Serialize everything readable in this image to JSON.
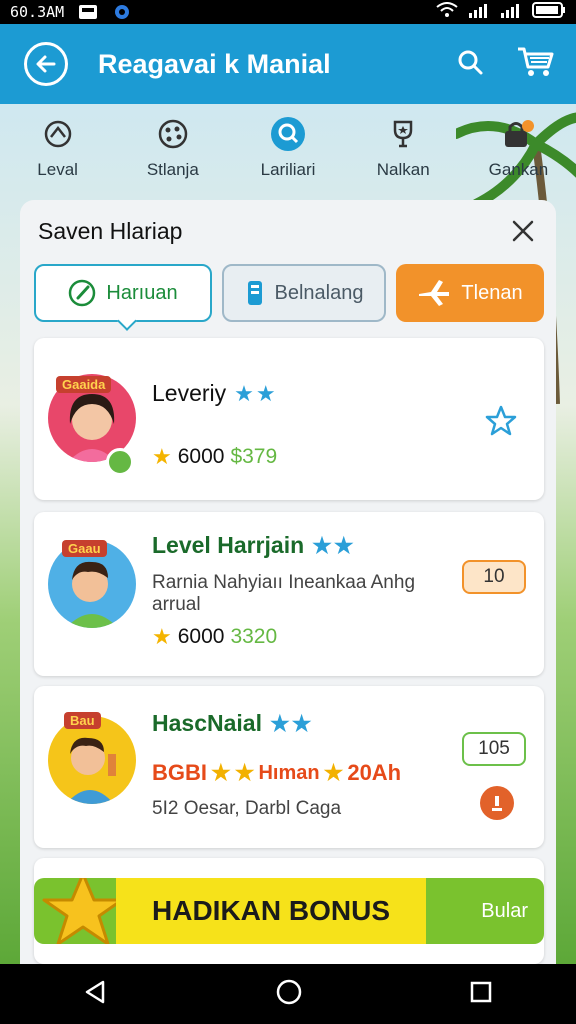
{
  "status": {
    "time": "60.3AM"
  },
  "appbar": {
    "title": "Reagavai k Manial"
  },
  "categories": [
    {
      "label": "Leval",
      "icon": "puzzle-icon"
    },
    {
      "label": "Stlanja",
      "icon": "palette-icon"
    },
    {
      "label": "Lariliari",
      "icon": "search-circle-icon"
    },
    {
      "label": "Nalkan",
      "icon": "trophy-icon"
    },
    {
      "label": "Gankan",
      "icon": "lock-icon"
    }
  ],
  "panel": {
    "title": "Saven Hlariap",
    "tabs": [
      {
        "label": "Harıuan"
      },
      {
        "label": "Belnalang"
      },
      {
        "label": "Tlenan"
      }
    ]
  },
  "cards": [
    {
      "title": "Leveriy",
      "badge_text": "Gaaida",
      "points": "6000",
      "price": "$379"
    },
    {
      "title": "Level Harrjain",
      "badge_text": "Gaau",
      "desc": "Rarnia Nahyiaıı Ineankaa Anhg arrual",
      "points": "6000",
      "price": "3320",
      "count": "10"
    },
    {
      "title": "HascNaial",
      "badge_text": "Bau",
      "promo_a": "BGBI",
      "promo_b": "Hıman",
      "promo_c": "20Ah",
      "desc": "5I2 Oesar, Darbl Caga",
      "count": "105"
    }
  ],
  "banner": {
    "text": "HADIKAN BONUS",
    "side": "Bular"
  },
  "colors": {
    "appbar": "#1c9bd3",
    "accent_orange": "#f2922a",
    "accent_green": "#1b8c3a",
    "star_blue": "#2b9fd8"
  }
}
